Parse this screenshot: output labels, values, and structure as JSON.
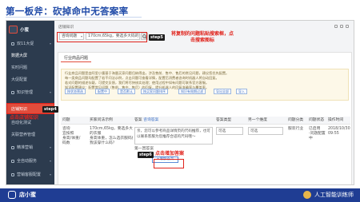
{
  "slide": {
    "title": "第一板斧：砍掉命中无答案率"
  },
  "app": {
    "logo_text": "小蜜"
  },
  "sidebar": {
    "items": [
      {
        "label": "双11大促"
      },
      {
        "label": "数据大屏"
      },
      {
        "label": "实时问题"
      },
      {
        "label": "大促配置"
      },
      {
        "label": "知识管理"
      },
      {
        "label": "店铺知识"
      },
      {
        "label": "自动化测试"
      },
      {
        "label": "关联营养管理"
      },
      {
        "label": "精准营销"
      },
      {
        "label": "全自动服务"
      },
      {
        "label": "营销客服配置"
      }
    ]
  },
  "header": {
    "breadcrumb": "店铺知识",
    "select_value": "咨询问题",
    "search_value": "170cm,65kg，要选多大码的？"
  },
  "annotations": {
    "step5_tag": "step5",
    "step5_text_l1": "将复制的问题粘贴搜索框，点",
    "step5_text_l2": "击搜索图标",
    "step4_tag": "step4",
    "step4_text": "点击店铺知识",
    "step6_tag": "step6",
    "step6_text": "点击增加答案"
  },
  "panel": {
    "tab": "行业商品问题",
    "tip_lines": [
      "行业商品问题是由阿里小蜜基于海量买家问题归纳得出，涉及售前、售中、售后的常见问题，建议您优先配置。",
      "每一类商品问题均配置了若干问法示例，点击问题可查看详情，配置后消费者咨询时机器人将自动回复。",
      "若对问题的描述存疑，可提交反馈，我们将尽快核实处理；使用过程中如有问题可联系官方客服。",
      "知识配置建议：配置常见问题（售前、售中、售后）的回复，提升机器人的回复准确率与覆盖率。"
    ],
    "filters": [
      "按状态筛选",
      "配置中",
      "是否默认",
      "按买家问题排序",
      "知识有效期过滤",
      "导出全部",
      "导入"
    ]
  },
  "table": {
    "headers": [
      "问题",
      "买家问法示例",
      "答案",
      "答案类型",
      "另一个维度",
      "问题分类",
      "问题状态",
      "操作时间"
    ],
    "row": {
      "question": [
        "咨询",
        "宜按照",
        "身高/体重/",
        "码数"
      ],
      "example": [
        "170cm,65kg，要选多大码",
        "的衣服",
        "身高体重，怎么选衣服码数？",
        "我该穿什么码？"
      ],
      "answer_text": "亲，您可以参考商品详情页的尺码推荐，也可以联系客服为您推荐合适的尺码哦～",
      "answer_label": "第一回答案",
      "answer_type": "可选",
      "dim": "可选",
      "category": "服装行业",
      "status": [
        "已启用",
        "·问题配置",
        "中"
      ],
      "time": [
        "2018/10/30",
        "09:55"
      ]
    },
    "add_answer": "+增加答案",
    "header_link": "咨询答案"
  },
  "bottom": {
    "logo_text": "店小蜜",
    "right_text": "人工智能训练师"
  }
}
